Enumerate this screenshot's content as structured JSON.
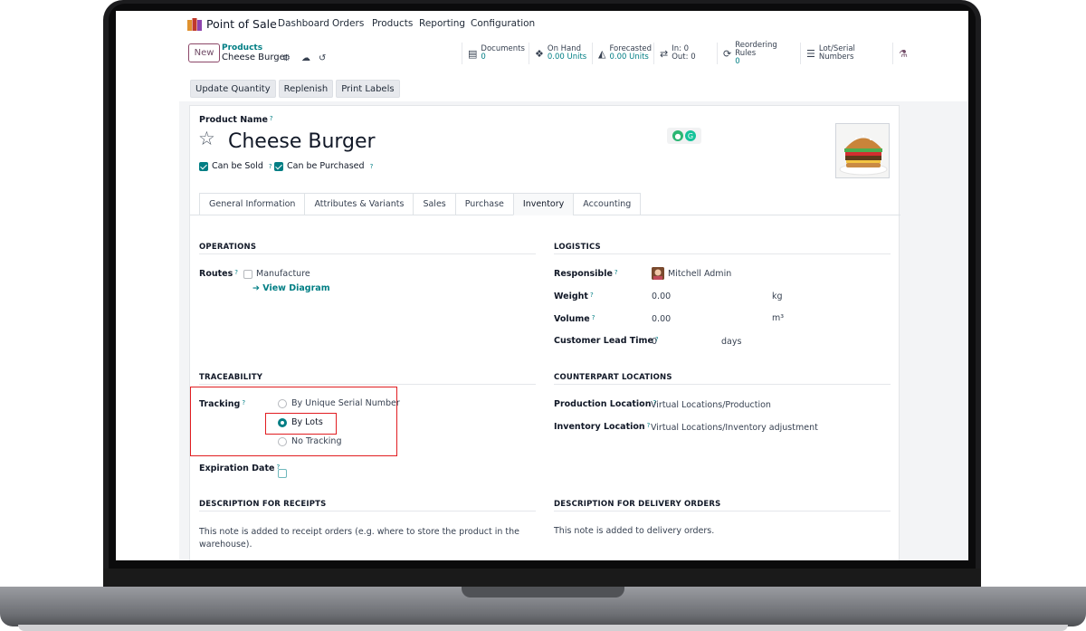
{
  "app": {
    "name": "Point of Sale",
    "nav": [
      "Dashboard",
      "Orders",
      "Products",
      "Reporting",
      "Configuration"
    ]
  },
  "control": {
    "new_label": "New",
    "breadcrumb_parent": "Products",
    "breadcrumb_current": "Cheese Burger"
  },
  "stats": [
    {
      "icon": "documents-icon",
      "label": "Documents",
      "value": "0"
    },
    {
      "icon": "cubes-icon",
      "label": "On Hand",
      "value": "0.00 Units"
    },
    {
      "icon": "area-chart-icon",
      "label": "Forecasted",
      "value": "0.00 Units"
    },
    {
      "icon": "in-out-arrows-icon",
      "label": "In: 0",
      "value": "Out: 0"
    },
    {
      "icon": "refresh-icon",
      "label": "Reordering Rules",
      "value": "0"
    },
    {
      "icon": "list-icon",
      "label": "Lot/Serial Numbers",
      "value": ""
    }
  ],
  "actions": [
    "Update Quantity",
    "Replenish",
    "Print Labels"
  ],
  "product": {
    "name_label": "Product Name",
    "name": "Cheese Burger",
    "can_be_sold": "Can be Sold",
    "can_be_purchased": "Can be Purchased",
    "help_mark": "?"
  },
  "tabs": [
    "General Information",
    "Attributes & Variants",
    "Sales",
    "Purchase",
    "Inventory",
    "Accounting"
  ],
  "active_tab": "Inventory",
  "operations": {
    "title": "OPERATIONS",
    "routes_label": "Routes",
    "manufacture": "Manufacture",
    "view_diagram": "View Diagram"
  },
  "logistics": {
    "title": "LOGISTICS",
    "responsible_label": "Responsible",
    "responsible_value": "Mitchell Admin",
    "weight_label": "Weight",
    "weight_value": "0.00",
    "weight_unit": "kg",
    "volume_label": "Volume",
    "volume_value": "0.00",
    "volume_unit": "m³",
    "lead_label": "Customer Lead Time",
    "lead_value": "0",
    "lead_unit": "days"
  },
  "traceability": {
    "title": "TRACEABILITY",
    "tracking_label": "Tracking",
    "options": [
      "By Unique Serial Number",
      "By Lots",
      "No Tracking"
    ],
    "selected": "By Lots",
    "expiration_label": "Expiration Date"
  },
  "counterpart": {
    "title": "COUNTERPART LOCATIONS",
    "production_label": "Production Location",
    "production_value": "Virtual Locations/Production",
    "inventory_label": "Inventory Location",
    "inventory_value": "Virtual Locations/Inventory adjustment"
  },
  "receipts": {
    "title": "DESCRIPTION FOR RECEIPTS",
    "note_line1": "This note is added to receipt orders (e.g. where to store the product in the",
    "note_line2": "warehouse)."
  },
  "delivery": {
    "title": "DESCRIPTION FOR DELIVERY ORDERS",
    "note": "This note is added to delivery orders."
  }
}
